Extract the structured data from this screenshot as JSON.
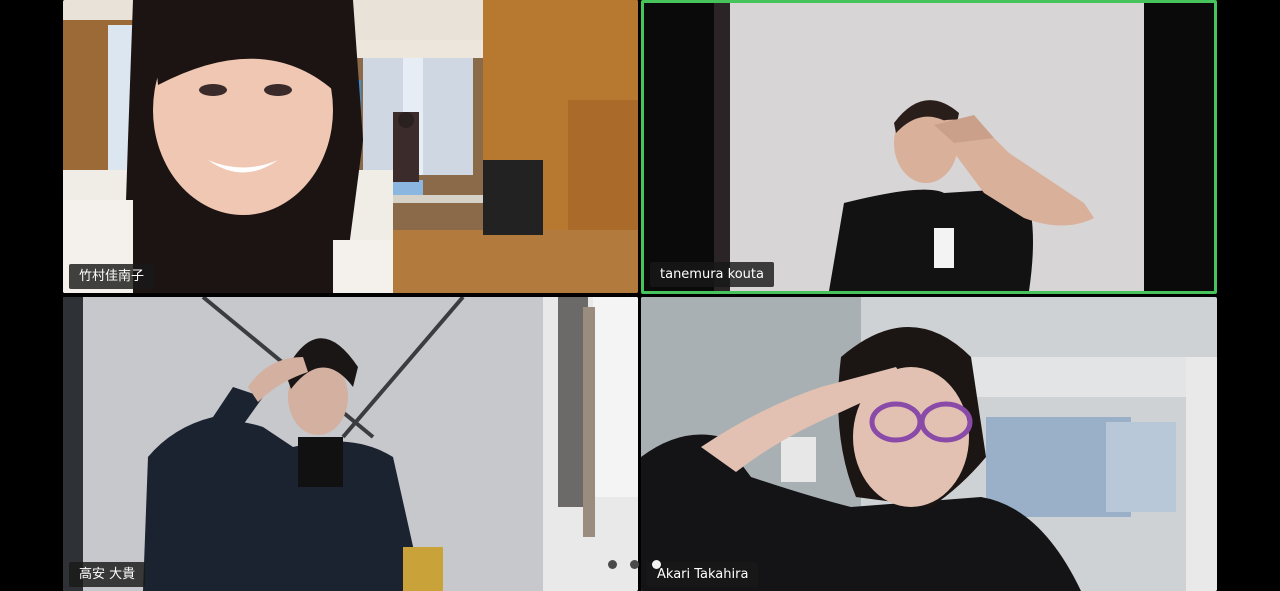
{
  "meeting": {
    "participants": [
      {
        "name": "竹村佳南子",
        "active": false,
        "video": "woman-smiling-in-hall"
      },
      {
        "name": "tanemura kouta",
        "active": true,
        "video": "man-saluting-white-wall"
      },
      {
        "name": "高安 大貴",
        "active": false,
        "video": "man-saluting-gray-wall"
      },
      {
        "name": "Akari Takahira",
        "active": false,
        "video": "woman-glasses-saluting"
      }
    ],
    "pager": {
      "total": 3,
      "current": 3
    }
  },
  "colors": {
    "active_speaker_border": "#46c35a",
    "name_tag_bg": "#191919",
    "background": "#000000"
  }
}
